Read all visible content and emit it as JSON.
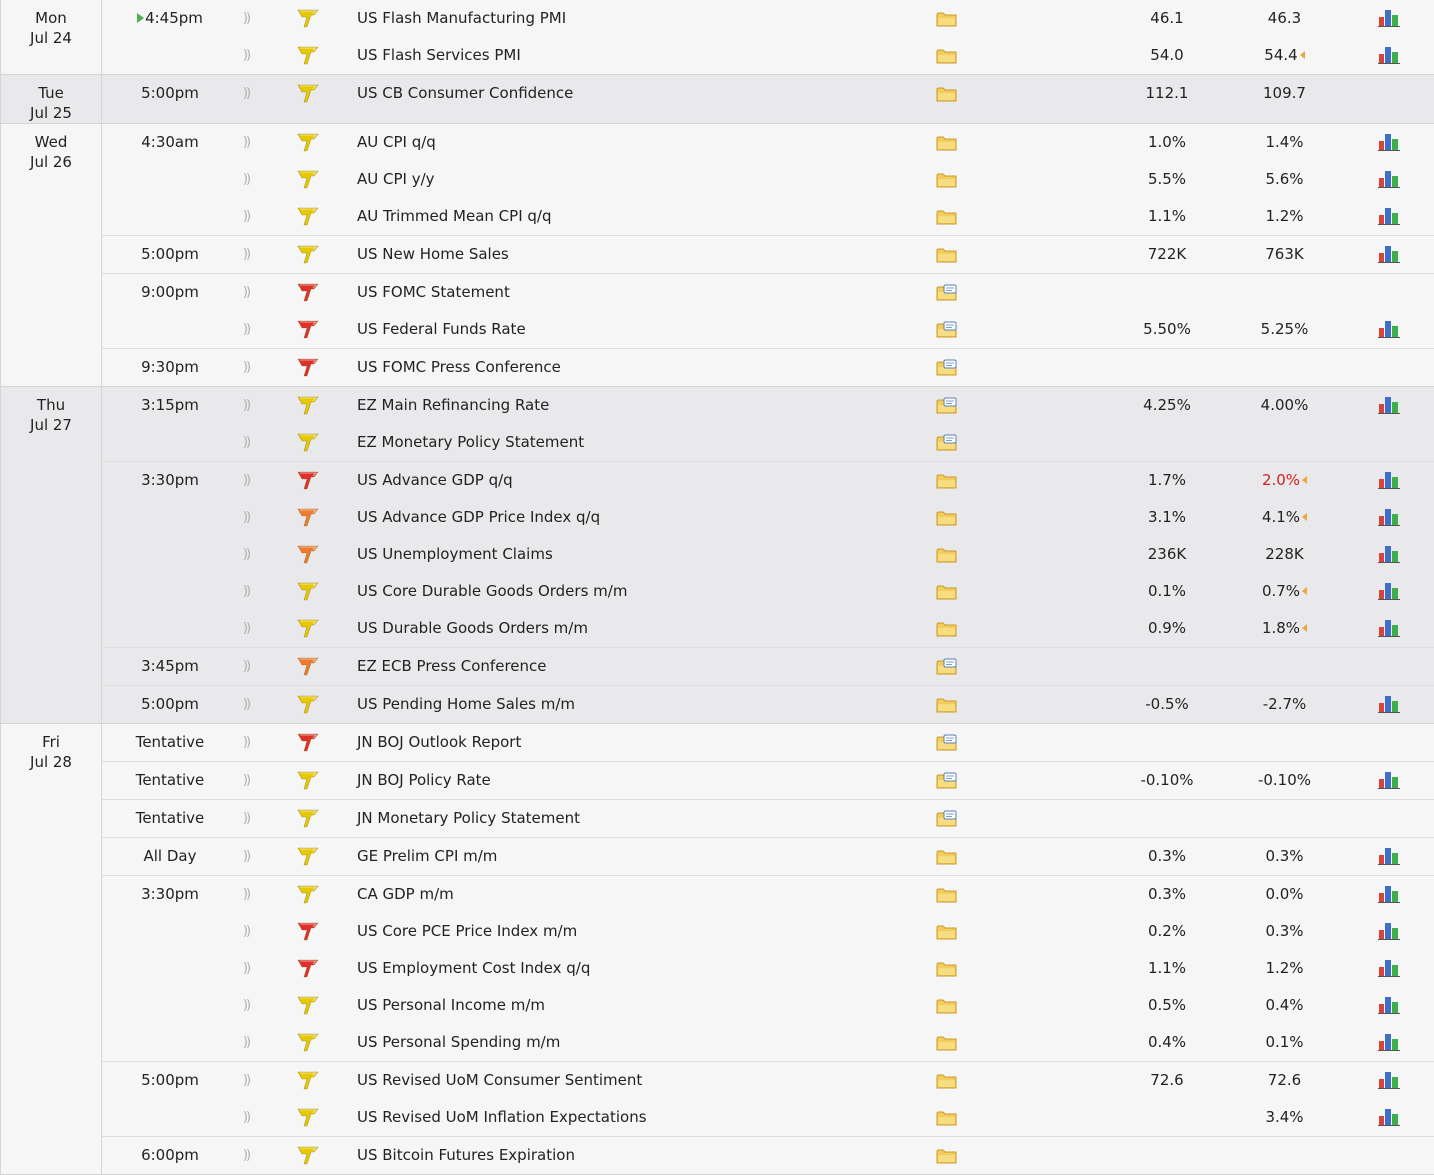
{
  "colors": {
    "impact_high": "#e0302b",
    "impact_medium": "#f07a2d",
    "impact_low": "#e8c800",
    "worse_value": "#d02020",
    "revision_marker": "#f2a33a",
    "current_marker": "#4caf50"
  },
  "days": [
    {
      "weekday": "Mon",
      "date": "Jul 24",
      "shade": false,
      "groups": [
        {
          "time": "4:45pm",
          "current": true,
          "events": [
            {
              "name": "US Flash Manufacturing PMI",
              "impact": "low",
              "folder": "folder-icon",
              "forecast": "46.1",
              "previous": "46.3",
              "chart": true
            },
            {
              "name": "US Flash Services PMI",
              "impact": "low",
              "folder": "folder-icon",
              "forecast": "54.0",
              "previous": "54.4",
              "revised": true,
              "chart": true
            }
          ]
        }
      ]
    },
    {
      "weekday": "Tue",
      "date": "Jul 25",
      "shade": true,
      "groups": [
        {
          "time": "5:00pm",
          "events": [
            {
              "name": "US CB Consumer Confidence",
              "impact": "low",
              "folder": "folder-icon",
              "forecast": "112.1",
              "previous": "109.7",
              "chart": false
            }
          ]
        }
      ]
    },
    {
      "weekday": "Wed",
      "date": "Jul 26",
      "shade": false,
      "groups": [
        {
          "time": "4:30am",
          "events": [
            {
              "name": "AU CPI q/q",
              "impact": "low",
              "folder": "folder-icon",
              "forecast": "1.0%",
              "previous": "1.4%",
              "chart": true
            },
            {
              "name": "AU CPI y/y",
              "impact": "low",
              "folder": "folder-icon",
              "forecast": "5.5%",
              "previous": "5.6%",
              "chart": true
            },
            {
              "name": "AU Trimmed Mean CPI q/q",
              "impact": "low",
              "folder": "folder-icon",
              "forecast": "1.1%",
              "previous": "1.2%",
              "chart": true
            }
          ]
        },
        {
          "time": "5:00pm",
          "events": [
            {
              "name": "US New Home Sales",
              "impact": "low",
              "folder": "folder-icon",
              "forecast": "722K",
              "previous": "763K",
              "chart": true
            }
          ]
        },
        {
          "time": "9:00pm",
          "events": [
            {
              "name": "US FOMC Statement",
              "impact": "high",
              "folder": "speech-folder-icon",
              "forecast": "",
              "previous": "",
              "chart": false
            },
            {
              "name": "US Federal Funds Rate",
              "impact": "high",
              "folder": "speech-folder-icon",
              "forecast": "5.50%",
              "previous": "5.25%",
              "chart": true
            }
          ]
        },
        {
          "time": "9:30pm",
          "events": [
            {
              "name": "US FOMC Press Conference",
              "impact": "high",
              "folder": "speech-folder-icon",
              "forecast": "",
              "previous": "",
              "chart": false
            }
          ]
        }
      ]
    },
    {
      "weekday": "Thu",
      "date": "Jul 27",
      "shade": true,
      "groups": [
        {
          "time": "3:15pm",
          "events": [
            {
              "name": "EZ Main Refinancing Rate",
              "impact": "low",
              "folder": "speech-folder-icon",
              "forecast": "4.25%",
              "previous": "4.00%",
              "chart": true
            },
            {
              "name": "EZ Monetary Policy Statement",
              "impact": "low",
              "folder": "speech-folder-icon",
              "forecast": "",
              "previous": "",
              "chart": false
            }
          ]
        },
        {
          "time": "3:30pm",
          "events": [
            {
              "name": "US Advance GDP q/q",
              "impact": "high",
              "folder": "folder-icon",
              "forecast": "1.7%",
              "previous": "2.0%",
              "previous_worse": true,
              "revised": true,
              "chart": true
            },
            {
              "name": "US Advance GDP Price Index q/q",
              "impact": "medium",
              "folder": "folder-icon",
              "forecast": "3.1%",
              "previous": "4.1%",
              "revised": true,
              "chart": true
            },
            {
              "name": "US Unemployment Claims",
              "impact": "medium",
              "folder": "folder-icon",
              "forecast": "236K",
              "previous": "228K",
              "chart": true
            },
            {
              "name": "US Core Durable Goods Orders m/m",
              "impact": "low",
              "folder": "folder-icon",
              "forecast": "0.1%",
              "previous": "0.7%",
              "revised": true,
              "chart": true
            },
            {
              "name": "US Durable Goods Orders m/m",
              "impact": "low",
              "folder": "folder-icon",
              "forecast": "0.9%",
              "previous": "1.8%",
              "revised": true,
              "chart": true
            }
          ]
        },
        {
          "time": "3:45pm",
          "events": [
            {
              "name": "EZ ECB Press Conference",
              "impact": "medium",
              "folder": "speech-folder-icon",
              "forecast": "",
              "previous": "",
              "chart": false
            }
          ]
        },
        {
          "time": "5:00pm",
          "events": [
            {
              "name": "US Pending Home Sales m/m",
              "impact": "low",
              "folder": "folder-icon",
              "forecast": "-0.5%",
              "previous": "-2.7%",
              "chart": true
            }
          ]
        }
      ]
    },
    {
      "weekday": "Fri",
      "date": "Jul 28",
      "shade": false,
      "groups": [
        {
          "time": "Tentative",
          "events": [
            {
              "name": "JN BOJ Outlook Report",
              "impact": "high",
              "folder": "speech-folder-icon",
              "forecast": "",
              "previous": "",
              "chart": false
            }
          ]
        },
        {
          "time": "Tentative",
          "events": [
            {
              "name": "JN BOJ Policy Rate",
              "impact": "low",
              "folder": "speech-folder-icon",
              "forecast": "-0.10%",
              "previous": "-0.10%",
              "chart": true
            }
          ]
        },
        {
          "time": "Tentative",
          "events": [
            {
              "name": "JN Monetary Policy Statement",
              "impact": "low",
              "folder": "speech-folder-icon",
              "forecast": "",
              "previous": "",
              "chart": false
            }
          ]
        },
        {
          "time": "All Day",
          "events": [
            {
              "name": "GE Prelim CPI m/m",
              "impact": "low",
              "folder": "folder-icon",
              "forecast": "0.3%",
              "previous": "0.3%",
              "chart": true
            }
          ]
        },
        {
          "time": "3:30pm",
          "events": [
            {
              "name": "CA GDP m/m",
              "impact": "low",
              "folder": "folder-icon",
              "forecast": "0.3%",
              "previous": "0.0%",
              "chart": true
            },
            {
              "name": "US Core PCE Price Index m/m",
              "impact": "high",
              "folder": "folder-icon",
              "forecast": "0.2%",
              "previous": "0.3%",
              "chart": true
            },
            {
              "name": "US Employment Cost Index q/q",
              "impact": "high",
              "folder": "folder-icon",
              "forecast": "1.1%",
              "previous": "1.2%",
              "chart": true
            },
            {
              "name": "US Personal Income m/m",
              "impact": "low",
              "folder": "folder-icon",
              "forecast": "0.5%",
              "previous": "0.4%",
              "chart": true
            },
            {
              "name": "US Personal Spending m/m",
              "impact": "low",
              "folder": "folder-icon",
              "forecast": "0.4%",
              "previous": "0.1%",
              "chart": true
            }
          ]
        },
        {
          "time": "5:00pm",
          "events": [
            {
              "name": "US Revised UoM Consumer Sentiment",
              "impact": "low",
              "folder": "folder-icon",
              "forecast": "72.6",
              "previous": "72.6",
              "chart": true
            },
            {
              "name": "US Revised UoM Inflation Expectations",
              "impact": "low",
              "folder": "folder-icon",
              "forecast": "",
              "previous": "3.4%",
              "chart": true
            }
          ]
        },
        {
          "time": "6:00pm",
          "events": [
            {
              "name": "US Bitcoin Futures Expiration",
              "impact": "low",
              "folder": "folder-icon",
              "forecast": "",
              "previous": "",
              "chart": false
            }
          ]
        }
      ]
    }
  ]
}
